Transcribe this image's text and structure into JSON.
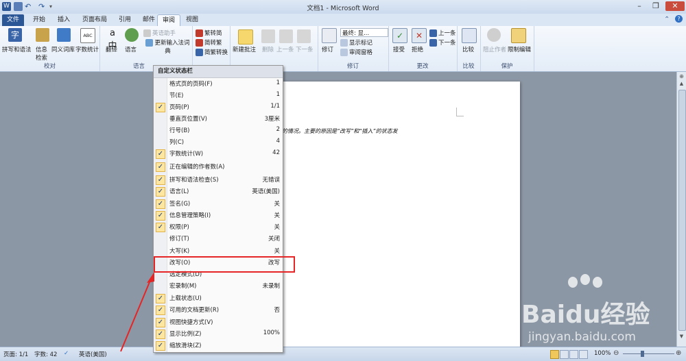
{
  "window": {
    "title": "文档1 - Microsoft Word",
    "minimize": "–",
    "restore": "❐",
    "close": "✕"
  },
  "tabs": [
    {
      "label": "文件"
    },
    {
      "label": "开始"
    },
    {
      "label": "插入"
    },
    {
      "label": "页面布局"
    },
    {
      "label": "引用"
    },
    {
      "label": "邮件"
    },
    {
      "label": "审阅"
    },
    {
      "label": "视图"
    }
  ],
  "ribbon": {
    "proofing": {
      "label": "校对",
      "spell": "拼写和语法",
      "info": "信息",
      "info2": "检索",
      "thesaurus": "同义词库",
      "wordcount": "字数统计"
    },
    "language": {
      "label": "语言",
      "translate": "翻译",
      "lang": "语言",
      "ime": "英语助手",
      "update_ime": "更新输入法词典"
    },
    "chinese": {
      "t2s": "繁转简",
      "s2t": "简转繁",
      "convert": "简繁转换"
    },
    "comments": {
      "new": "新建批注",
      "delete": "删除",
      "prev": "上一条",
      "next": "下一条"
    },
    "tracking": {
      "label": "修订",
      "track": "修订",
      "final": "最终: 显...",
      "markup": "显示标记",
      "pane": "审阅窗格"
    },
    "changes": {
      "label": "更改",
      "accept": "接受",
      "reject": "拒绝",
      "prev": "上一条",
      "next": "下一条"
    },
    "compare": {
      "label": "比较",
      "compare": "比较"
    },
    "protect": {
      "label": "保护",
      "block": "阻止作者",
      "restrict": "限制编辑"
    }
  },
  "document": {
    "text": "删除后面的文字的情况。主要的原因是“改写”和“插入”的状态发"
  },
  "menu": {
    "title": "自定义状态栏",
    "items": [
      {
        "label": "格式页的页码(F)",
        "value": "1",
        "checked": false
      },
      {
        "label": "节(E)",
        "value": "1",
        "checked": false
      },
      {
        "label": "页码(P)",
        "value": "1/1",
        "checked": true
      },
      {
        "label": "垂直页位置(V)",
        "value": "3厘米",
        "checked": false
      },
      {
        "label": "行号(B)",
        "value": "2",
        "checked": false
      },
      {
        "label": "列(C)",
        "value": "4",
        "checked": false
      },
      {
        "label": "字数统计(W)",
        "value": "42",
        "checked": true
      },
      {
        "label": "正在编辑的作者数(A)",
        "value": "",
        "checked": true
      },
      {
        "label": "拼写和语法检查(S)",
        "value": "无错误",
        "checked": true
      },
      {
        "label": "语言(L)",
        "value": "英语(美国)",
        "checked": true
      },
      {
        "label": "签名(G)",
        "value": "关",
        "checked": true
      },
      {
        "label": "信息管理策略(I)",
        "value": "关",
        "checked": true
      },
      {
        "label": "权限(P)",
        "value": "关",
        "checked": true
      },
      {
        "label": "修订(T)",
        "value": "关闭",
        "checked": false
      },
      {
        "label": "大写(K)",
        "value": "关",
        "checked": false
      },
      {
        "label": "改写(O)",
        "value": "改写",
        "checked": false
      },
      {
        "label": "选定模式(D)",
        "value": "",
        "checked": false
      },
      {
        "label": "宏录制(M)",
        "value": "未录制",
        "checked": false
      },
      {
        "label": "上载状态(U)",
        "value": "",
        "checked": true
      },
      {
        "label": "可用的文档更新(R)",
        "value": "否",
        "checked": true
      },
      {
        "label": "视图快捷方式(V)",
        "value": "",
        "checked": true
      },
      {
        "label": "显示比例(Z)",
        "value": "100%",
        "checked": true
      },
      {
        "label": "缩放滑块(Z)",
        "value": "",
        "checked": true
      }
    ]
  },
  "status": {
    "page": "页面: 1/1",
    "words": "字数: 42",
    "lang": "英语(美国)",
    "zoom": "100%"
  },
  "watermark": {
    "logo": "Baidu经验",
    "url": "jingyan.baidu.com"
  },
  "colors": {
    "file_tab": "#2b5797",
    "highlight": "#e52525",
    "checkbox": "#fde7a0"
  }
}
